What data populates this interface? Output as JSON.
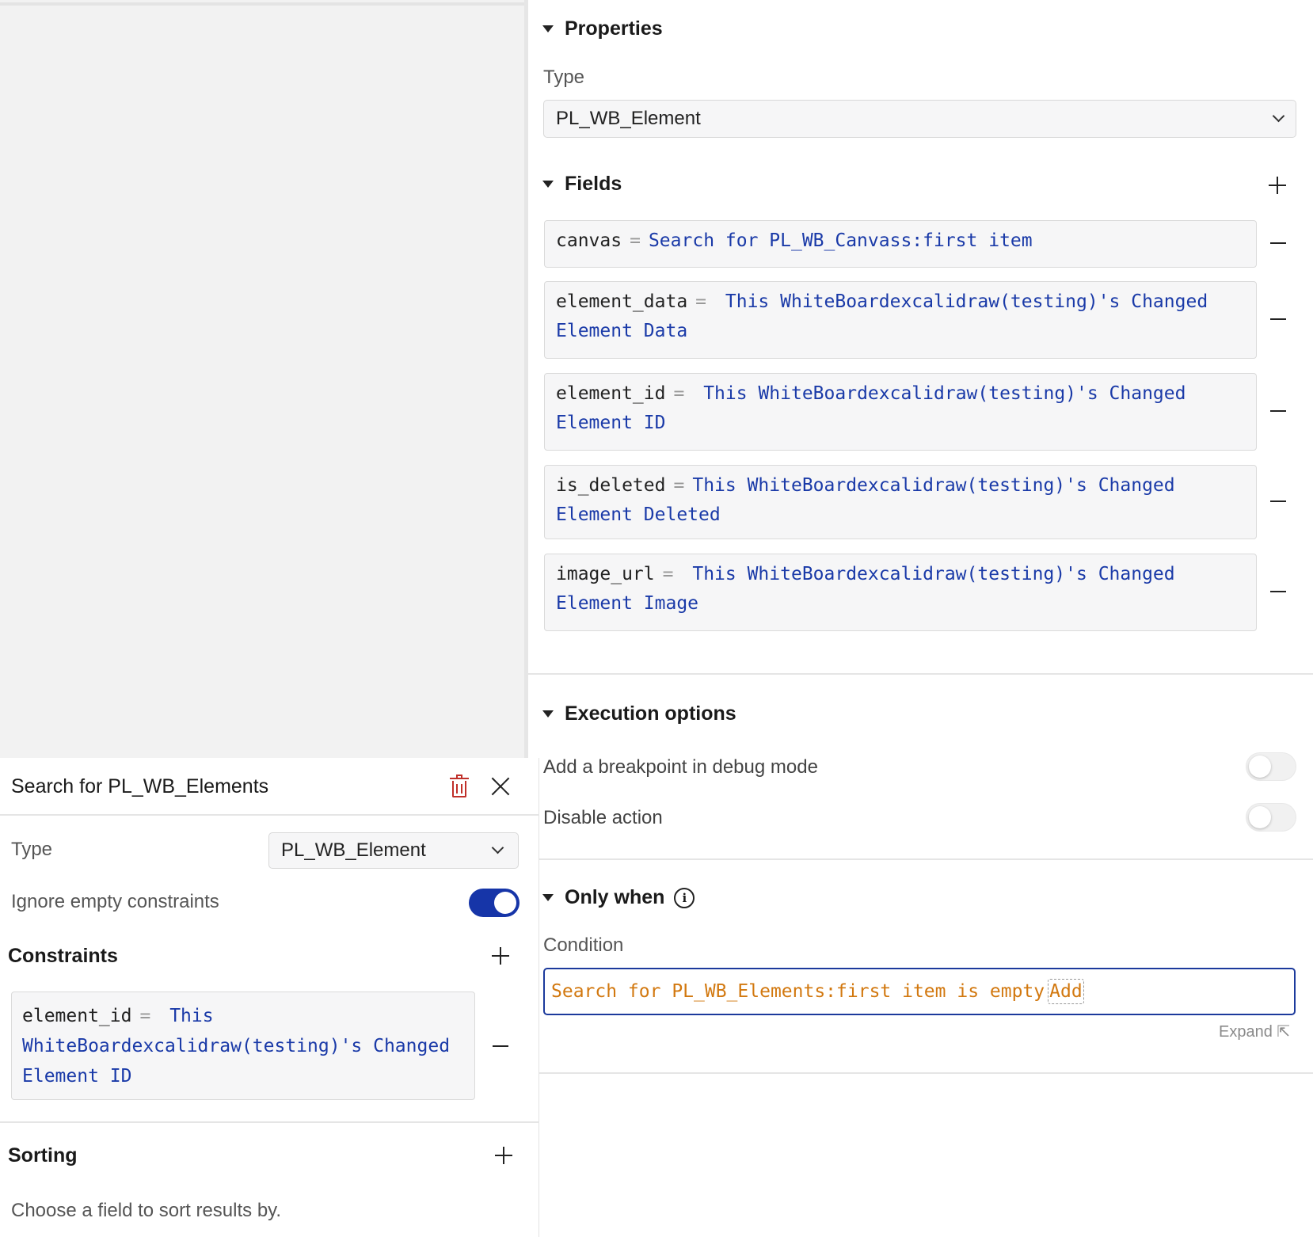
{
  "properties": {
    "heading": "Properties",
    "type_label": "Type",
    "type_value": "PL_WB_Element"
  },
  "fields": {
    "heading": "Fields",
    "items": [
      {
        "name": "canvas",
        "value": "Search for PL_WB_Canvass:first item"
      },
      {
        "name": "element_data",
        "value": "This WhiteBoardexcalidraw(testing)'s Changed Element Data"
      },
      {
        "name": "element_id",
        "value": "This WhiteBoardexcalidraw(testing)'s Changed Element ID"
      },
      {
        "name": "is_deleted",
        "value": "This WhiteBoardexcalidraw(testing)'s Changed Element Deleted"
      },
      {
        "name": "image_url",
        "value": "This WhiteBoardexcalidraw(testing)'s Changed Element Image"
      }
    ]
  },
  "execution": {
    "heading": "Execution options",
    "breakpoint_label": "Add a breakpoint in debug mode",
    "disable_label": "Disable action"
  },
  "only_when": {
    "heading": "Only when",
    "condition_label": "Condition",
    "condition_value": "Search for PL_WB_Elements:first item is empty",
    "add_chip": "Add",
    "expand_label": "Expand ⇱"
  },
  "popup": {
    "title": "Search for PL_WB_Elements",
    "type_label": "Type",
    "type_value": "PL_WB_Element",
    "ignore_label": "Ignore empty constraints",
    "constraints_heading": "Constraints",
    "constraint": {
      "name": "element_id",
      "op": "=",
      "value": "This WhiteBoardexcalidraw(testing)'s Changed Element ID"
    },
    "sorting_heading": "Sorting",
    "sorting_hint": "Choose a field to sort results by."
  },
  "colors": {
    "accent": "#1635a8",
    "dynamic_text": "#1a3aa8",
    "condition_text": "#d2780f",
    "delete_red": "#c0302a"
  },
  "state": {
    "breakpoint_toggle": false,
    "disable_toggle": false,
    "ignore_empty_toggle": true
  },
  "icons": [
    "caret-down-icon",
    "chevron-down-icon",
    "plus-icon",
    "minus-icon",
    "info-icon",
    "trash-icon",
    "close-icon",
    "expand-icon"
  ]
}
